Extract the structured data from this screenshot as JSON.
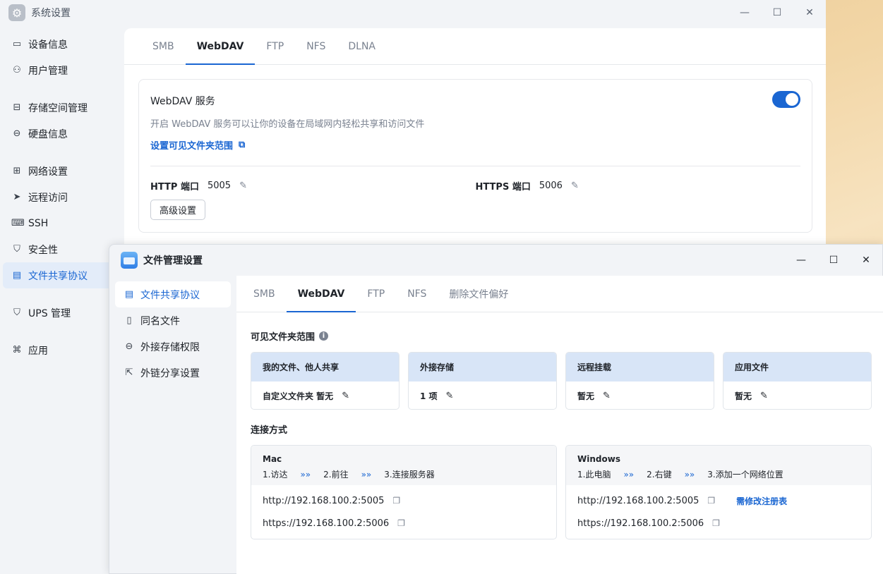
{
  "win1": {
    "title": "系统设置",
    "controls": {
      "min": "—",
      "max": "☐",
      "close": "✕"
    },
    "sidebar": [
      {
        "label": "设备信息",
        "icon": "device-icon",
        "glyph": "▭"
      },
      {
        "label": "用户管理",
        "icon": "user-icon",
        "glyph": "⚇"
      },
      {
        "label": "存储空间管理",
        "icon": "storage-icon",
        "glyph": "⊟"
      },
      {
        "label": "硬盘信息",
        "icon": "disk-icon",
        "glyph": "⊖"
      },
      {
        "label": "网络设置",
        "icon": "network-icon",
        "glyph": "⊞"
      },
      {
        "label": "远程访问",
        "icon": "send-icon",
        "glyph": "➤"
      },
      {
        "label": "SSH",
        "icon": "code-icon",
        "glyph": "⌨"
      },
      {
        "label": "安全性",
        "icon": "shield-icon",
        "glyph": "⛉"
      },
      {
        "label": "文件共享协议",
        "icon": "doc-icon",
        "glyph": "▤"
      },
      {
        "label": "UPS 管理",
        "icon": "ups-icon",
        "glyph": "⛉"
      },
      {
        "label": "应用",
        "icon": "apps-icon",
        "glyph": "⌘"
      }
    ],
    "tabs": [
      "SMB",
      "WebDAV",
      "FTP",
      "NFS",
      "DLNA"
    ],
    "service": {
      "title": "WebDAV 服务",
      "desc": "开启 WebDAV 服务可以让你的设备在局域网内轻松共享和访问文件",
      "link": "设置可见文件夹范围",
      "http_label": "HTTP 端口",
      "http_port": "5005",
      "https_label": "HTTPS 端口",
      "https_port": "5006",
      "advanced": "高级设置",
      "enabled": true
    }
  },
  "win2": {
    "title": "文件管理设置",
    "sidebar": [
      {
        "label": "文件共享协议",
        "icon": "doc-icon",
        "glyph": "▤"
      },
      {
        "label": "同名文件",
        "icon": "file-icon",
        "glyph": "▯"
      },
      {
        "label": "外接存储权限",
        "icon": "disk-icon",
        "glyph": "⊖"
      },
      {
        "label": "外链分享设置",
        "icon": "share-icon",
        "glyph": "⇱"
      }
    ],
    "tabs": [
      "SMB",
      "WebDAV",
      "FTP",
      "NFS",
      "删除文件偏好"
    ],
    "visible_title": "可见文件夹范围",
    "scopes": [
      {
        "head": "我的文件、他人共享",
        "body": "自定义文件夹 暂无"
      },
      {
        "head": "外接存储",
        "body": "1 项"
      },
      {
        "head": "远程挂载",
        "body": "暂无"
      },
      {
        "head": "应用文件",
        "body": "暂无"
      }
    ],
    "connect_title": "连接方式",
    "mac": {
      "os": "Mac",
      "steps": [
        "1.访达",
        "2.前往",
        "3.连接服务器"
      ],
      "http": "http://192.168.100.2:5005",
      "https": "https://192.168.100.2:5006"
    },
    "windows": {
      "os": "Windows",
      "steps": [
        "1.此电脑",
        "2.右键",
        "3.添加一个网络位置"
      ],
      "http": "http://192.168.100.2:5005",
      "https": "https://192.168.100.2:5006",
      "registry": "需修改注册表"
    }
  }
}
